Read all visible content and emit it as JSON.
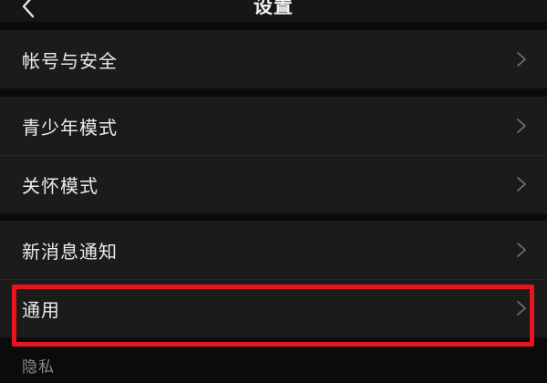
{
  "header": {
    "title": "设置"
  },
  "groups": [
    {
      "items": [
        {
          "label": "帐号与安全"
        }
      ]
    },
    {
      "items": [
        {
          "label": "青少年模式"
        },
        {
          "label": "关怀模式"
        }
      ]
    },
    {
      "items": [
        {
          "label": "新消息通知"
        },
        {
          "label": "通用"
        }
      ]
    }
  ],
  "section_caption": "隐私",
  "icons": {
    "back": "chevron-left-icon",
    "row_arrow": "chevron-right-icon"
  },
  "colors": {
    "background": "#0b0b0b",
    "row_background": "#1b1b1b",
    "highlight": "#e8141e",
    "chevron": "#6e6e6e"
  }
}
